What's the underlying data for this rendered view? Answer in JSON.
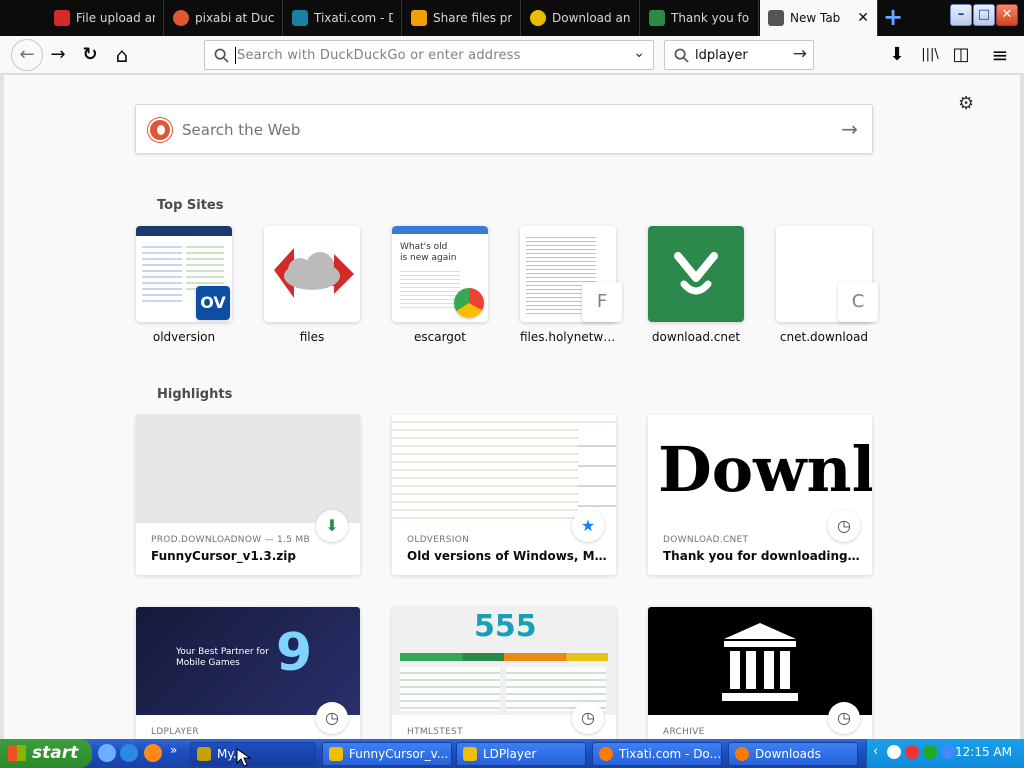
{
  "tabs": [
    {
      "title": "File upload an",
      "icon_color": "#d42a2a",
      "active": false
    },
    {
      "title": "pixabi at Duck",
      "icon_color": "#de5833",
      "active": false
    },
    {
      "title": "Tixati.com - D",
      "icon_color": "#1b7fa3",
      "active": false
    },
    {
      "title": "Share files priv",
      "icon_color": "#f0a000",
      "active": false
    },
    {
      "title": "Download and",
      "icon_color": "#e6c000",
      "active": false
    },
    {
      "title": "Thank you for",
      "icon_color": "#2b8a4b",
      "active": false
    },
    {
      "title": "New Tab",
      "icon_color": "#555555",
      "active": true
    }
  ],
  "tab_close_glyph": "✕",
  "new_tab_glyph": "+",
  "window_controls": {
    "minimize": "–",
    "maximize": "□",
    "close": "✕"
  },
  "nav": {
    "back": "←",
    "forward": "→",
    "reload": "↻",
    "home": "⌂"
  },
  "urlbar": {
    "placeholder": "Search with DuckDuckGo or enter address",
    "dropdown": "⌄",
    "icon": "search-icon"
  },
  "searchbar": {
    "value": "ldplayer",
    "go": "→",
    "icon": "search-icon"
  },
  "toolbar_right": {
    "download": "⬇",
    "library": "|||\\",
    "sidebar": "◫",
    "menu": "≡"
  },
  "content": {
    "settings_glyph": "⚙",
    "web_search": {
      "placeholder": "Search the Web",
      "arrow": "→"
    },
    "top_sites_title": "Top Sites",
    "top_sites": [
      {
        "label": "oldversion",
        "badge": "OV",
        "badge_color": "#0b4ea2"
      },
      {
        "label": "files",
        "badge": "",
        "badge_color": "#d42a2a"
      },
      {
        "label": "escargot",
        "badge": "",
        "badge_color": "#f4b400"
      },
      {
        "label": "files.holynetwor...",
        "badge": "F",
        "badge_color": "#ffffff"
      },
      {
        "label": "download.cnet",
        "badge": "",
        "badge_color": "#2b8a4b"
      },
      {
        "label": "cnet.download",
        "badge": "C",
        "badge_color": "#ffffff"
      }
    ],
    "highlights_title": "Highlights",
    "highlights": [
      {
        "source": "PROD.DOWNLOADNOW — 1.5 MB",
        "title": "FunnyCursor_v1.3.zip",
        "icon": "download-icon",
        "icon_glyph": "⬇",
        "icon_color": "#2b8a4b"
      },
      {
        "source": "OLDVERSION",
        "title": "Old versions of Windows, Mac a...",
        "icon": "bookmark-star-icon",
        "icon_glyph": "★",
        "icon_color": "#0a84ff"
      },
      {
        "source": "DOWNLOAD.CNET",
        "title": "Thank you for downloading Funn...",
        "icon": "history-clock-icon",
        "icon_glyph": "◷",
        "icon_color": "#4a4a4f",
        "image_text": "Downl"
      },
      {
        "source": "LDPLAYER",
        "title": "",
        "icon": "history-clock-icon",
        "icon_glyph": "◷",
        "icon_color": "#4a4a4f",
        "image_text": "9"
      },
      {
        "source": "HTML5TEST",
        "title": "",
        "icon": "history-clock-icon",
        "icon_glyph": "◷",
        "icon_color": "#4a4a4f",
        "image_text": "555"
      },
      {
        "source": "ARCHIVE",
        "title": "",
        "icon": "history-clock-icon",
        "icon_glyph": "◷",
        "icon_color": "#4a4a4f"
      }
    ]
  },
  "taskbar": {
    "start_label": "start",
    "buttons": [
      {
        "label": "My...",
        "icon_color": "#c8a000"
      },
      {
        "label": "FunnyCursor_v...",
        "icon_color": "#f0c000"
      },
      {
        "label": "LDPlayer",
        "icon_color": "#f0c000"
      },
      {
        "label": "Tixati.com - Do...",
        "icon_color": "#ff7a00"
      },
      {
        "label": "Downloads",
        "icon_color": "#ff7a00"
      }
    ],
    "clock": "12:15 AM"
  }
}
